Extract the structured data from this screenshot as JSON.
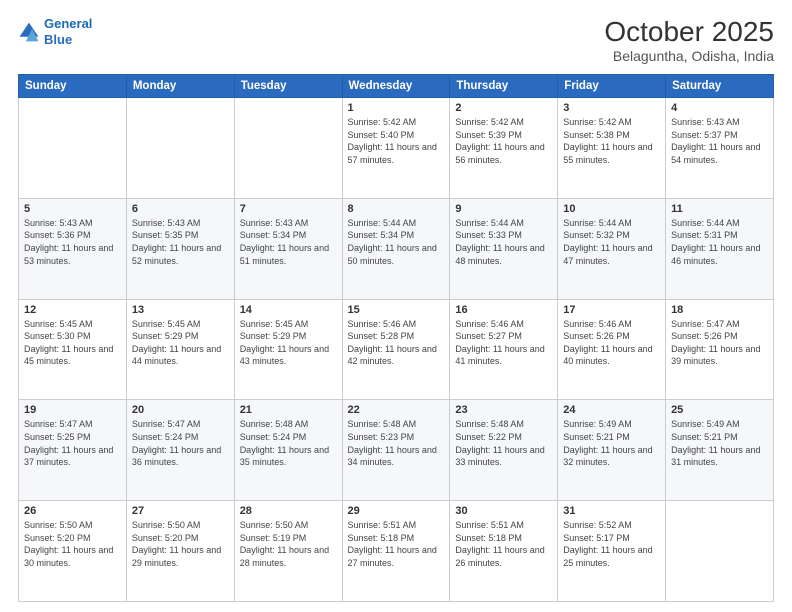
{
  "header": {
    "logo_line1": "General",
    "logo_line2": "Blue",
    "month": "October 2025",
    "location": "Belaguntha, Odisha, India"
  },
  "weekdays": [
    "Sunday",
    "Monday",
    "Tuesday",
    "Wednesday",
    "Thursday",
    "Friday",
    "Saturday"
  ],
  "weeks": [
    [
      {
        "day": "",
        "sunrise": "",
        "sunset": "",
        "daylight": ""
      },
      {
        "day": "",
        "sunrise": "",
        "sunset": "",
        "daylight": ""
      },
      {
        "day": "",
        "sunrise": "",
        "sunset": "",
        "daylight": ""
      },
      {
        "day": "1",
        "sunrise": "Sunrise: 5:42 AM",
        "sunset": "Sunset: 5:40 PM",
        "daylight": "Daylight: 11 hours and 57 minutes."
      },
      {
        "day": "2",
        "sunrise": "Sunrise: 5:42 AM",
        "sunset": "Sunset: 5:39 PM",
        "daylight": "Daylight: 11 hours and 56 minutes."
      },
      {
        "day": "3",
        "sunrise": "Sunrise: 5:42 AM",
        "sunset": "Sunset: 5:38 PM",
        "daylight": "Daylight: 11 hours and 55 minutes."
      },
      {
        "day": "4",
        "sunrise": "Sunrise: 5:43 AM",
        "sunset": "Sunset: 5:37 PM",
        "daylight": "Daylight: 11 hours and 54 minutes."
      }
    ],
    [
      {
        "day": "5",
        "sunrise": "Sunrise: 5:43 AM",
        "sunset": "Sunset: 5:36 PM",
        "daylight": "Daylight: 11 hours and 53 minutes."
      },
      {
        "day": "6",
        "sunrise": "Sunrise: 5:43 AM",
        "sunset": "Sunset: 5:35 PM",
        "daylight": "Daylight: 11 hours and 52 minutes."
      },
      {
        "day": "7",
        "sunrise": "Sunrise: 5:43 AM",
        "sunset": "Sunset: 5:34 PM",
        "daylight": "Daylight: 11 hours and 51 minutes."
      },
      {
        "day": "8",
        "sunrise": "Sunrise: 5:44 AM",
        "sunset": "Sunset: 5:34 PM",
        "daylight": "Daylight: 11 hours and 50 minutes."
      },
      {
        "day": "9",
        "sunrise": "Sunrise: 5:44 AM",
        "sunset": "Sunset: 5:33 PM",
        "daylight": "Daylight: 11 hours and 48 minutes."
      },
      {
        "day": "10",
        "sunrise": "Sunrise: 5:44 AM",
        "sunset": "Sunset: 5:32 PM",
        "daylight": "Daylight: 11 hours and 47 minutes."
      },
      {
        "day": "11",
        "sunrise": "Sunrise: 5:44 AM",
        "sunset": "Sunset: 5:31 PM",
        "daylight": "Daylight: 11 hours and 46 minutes."
      }
    ],
    [
      {
        "day": "12",
        "sunrise": "Sunrise: 5:45 AM",
        "sunset": "Sunset: 5:30 PM",
        "daylight": "Daylight: 11 hours and 45 minutes."
      },
      {
        "day": "13",
        "sunrise": "Sunrise: 5:45 AM",
        "sunset": "Sunset: 5:29 PM",
        "daylight": "Daylight: 11 hours and 44 minutes."
      },
      {
        "day": "14",
        "sunrise": "Sunrise: 5:45 AM",
        "sunset": "Sunset: 5:29 PM",
        "daylight": "Daylight: 11 hours and 43 minutes."
      },
      {
        "day": "15",
        "sunrise": "Sunrise: 5:46 AM",
        "sunset": "Sunset: 5:28 PM",
        "daylight": "Daylight: 11 hours and 42 minutes."
      },
      {
        "day": "16",
        "sunrise": "Sunrise: 5:46 AM",
        "sunset": "Sunset: 5:27 PM",
        "daylight": "Daylight: 11 hours and 41 minutes."
      },
      {
        "day": "17",
        "sunrise": "Sunrise: 5:46 AM",
        "sunset": "Sunset: 5:26 PM",
        "daylight": "Daylight: 11 hours and 40 minutes."
      },
      {
        "day": "18",
        "sunrise": "Sunrise: 5:47 AM",
        "sunset": "Sunset: 5:26 PM",
        "daylight": "Daylight: 11 hours and 39 minutes."
      }
    ],
    [
      {
        "day": "19",
        "sunrise": "Sunrise: 5:47 AM",
        "sunset": "Sunset: 5:25 PM",
        "daylight": "Daylight: 11 hours and 37 minutes."
      },
      {
        "day": "20",
        "sunrise": "Sunrise: 5:47 AM",
        "sunset": "Sunset: 5:24 PM",
        "daylight": "Daylight: 11 hours and 36 minutes."
      },
      {
        "day": "21",
        "sunrise": "Sunrise: 5:48 AM",
        "sunset": "Sunset: 5:24 PM",
        "daylight": "Daylight: 11 hours and 35 minutes."
      },
      {
        "day": "22",
        "sunrise": "Sunrise: 5:48 AM",
        "sunset": "Sunset: 5:23 PM",
        "daylight": "Daylight: 11 hours and 34 minutes."
      },
      {
        "day": "23",
        "sunrise": "Sunrise: 5:48 AM",
        "sunset": "Sunset: 5:22 PM",
        "daylight": "Daylight: 11 hours and 33 minutes."
      },
      {
        "day": "24",
        "sunrise": "Sunrise: 5:49 AM",
        "sunset": "Sunset: 5:21 PM",
        "daylight": "Daylight: 11 hours and 32 minutes."
      },
      {
        "day": "25",
        "sunrise": "Sunrise: 5:49 AM",
        "sunset": "Sunset: 5:21 PM",
        "daylight": "Daylight: 11 hours and 31 minutes."
      }
    ],
    [
      {
        "day": "26",
        "sunrise": "Sunrise: 5:50 AM",
        "sunset": "Sunset: 5:20 PM",
        "daylight": "Daylight: 11 hours and 30 minutes."
      },
      {
        "day": "27",
        "sunrise": "Sunrise: 5:50 AM",
        "sunset": "Sunset: 5:20 PM",
        "daylight": "Daylight: 11 hours and 29 minutes."
      },
      {
        "day": "28",
        "sunrise": "Sunrise: 5:50 AM",
        "sunset": "Sunset: 5:19 PM",
        "daylight": "Daylight: 11 hours and 28 minutes."
      },
      {
        "day": "29",
        "sunrise": "Sunrise: 5:51 AM",
        "sunset": "Sunset: 5:18 PM",
        "daylight": "Daylight: 11 hours and 27 minutes."
      },
      {
        "day": "30",
        "sunrise": "Sunrise: 5:51 AM",
        "sunset": "Sunset: 5:18 PM",
        "daylight": "Daylight: 11 hours and 26 minutes."
      },
      {
        "day": "31",
        "sunrise": "Sunrise: 5:52 AM",
        "sunset": "Sunset: 5:17 PM",
        "daylight": "Daylight: 11 hours and 25 minutes."
      },
      {
        "day": "",
        "sunrise": "",
        "sunset": "",
        "daylight": ""
      }
    ]
  ]
}
